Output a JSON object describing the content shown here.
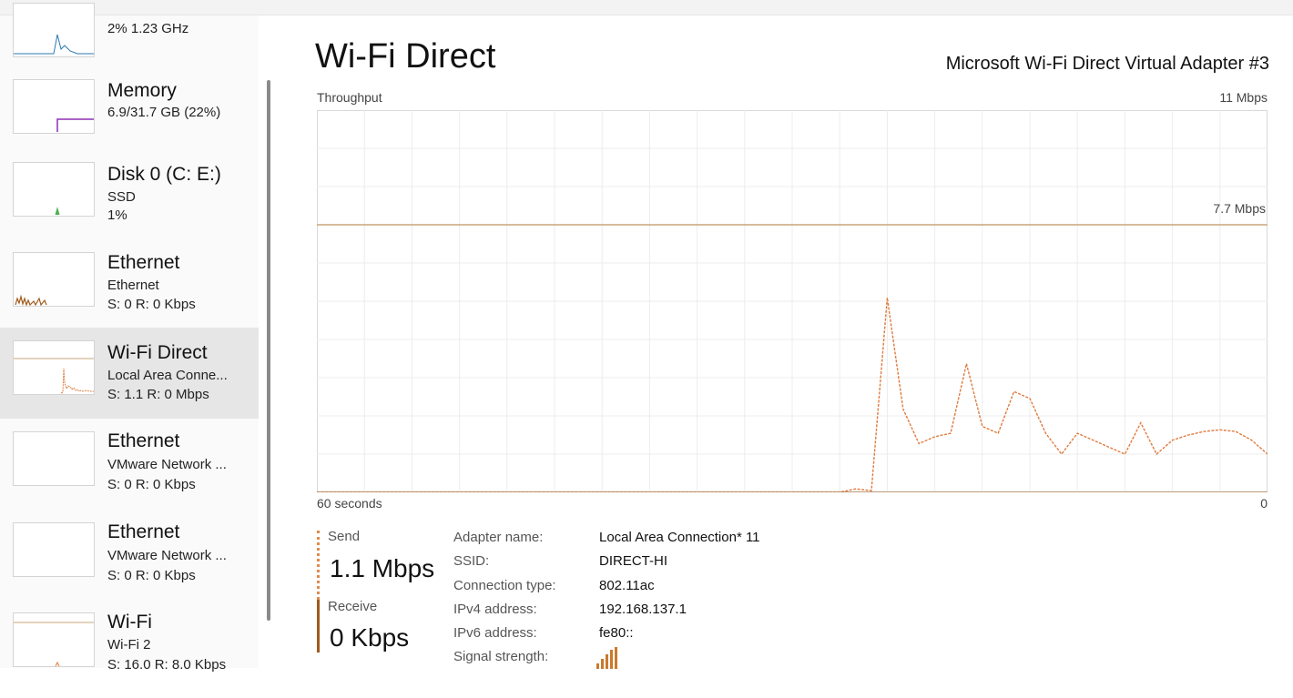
{
  "sidebar": {
    "items": [
      {
        "title": "",
        "subs": [
          "2% 1.23 GHz"
        ]
      },
      {
        "title": "Memory",
        "subs": [
          "6.9/31.7 GB (22%)"
        ]
      },
      {
        "title": "Disk 0 (C: E:)",
        "subs": [
          "SSD",
          "1%"
        ]
      },
      {
        "title": "Ethernet",
        "subs": [
          "Ethernet",
          "S: 0 R: 0 Kbps"
        ]
      },
      {
        "title": "Wi-Fi Direct",
        "subs": [
          "Local Area Conne...",
          "S: 1.1 R: 0 Mbps"
        ]
      },
      {
        "title": "Ethernet",
        "subs": [
          "VMware Network ...",
          "S: 0 R: 0 Kbps"
        ]
      },
      {
        "title": "Ethernet",
        "subs": [
          "VMware Network ...",
          "S: 0 R: 0 Kbps"
        ]
      },
      {
        "title": "Wi-Fi",
        "subs": [
          "Wi-Fi 2",
          "S: 16.0 R: 8.0 Kbps"
        ]
      }
    ]
  },
  "main": {
    "title": "Wi-Fi Direct",
    "adapter": "Microsoft Wi-Fi Direct Virtual Adapter #3",
    "chart_label": "Throughput",
    "max_label": "11 Mbps",
    "ref_label": "7.7 Mbps",
    "x_left_label": "60 seconds",
    "x_right_label": "0"
  },
  "stats": {
    "send_label": "Send",
    "send_value": "1.1 Mbps",
    "receive_label": "Receive",
    "receive_value": "0 Kbps"
  },
  "properties": [
    {
      "label": "Adapter name:",
      "value": "Local Area Connection* 11"
    },
    {
      "label": "SSID:",
      "value": "DIRECT-HI"
    },
    {
      "label": "Connection type:",
      "value": "802.11ac"
    },
    {
      "label": "IPv4 address:",
      "value": "192.168.137.1"
    },
    {
      "label": "IPv6 address:",
      "value": "fe80::"
    },
    {
      "label": "Signal strength:",
      "value": ""
    }
  ],
  "chart_data": {
    "type": "line",
    "title": "Throughput",
    "y_unit": "Mbps",
    "ylim": [
      0,
      11
    ],
    "xlim": [
      60,
      0
    ],
    "reference_line": 7.7,
    "grid": true,
    "series": [
      {
        "name": "Send",
        "color": "#e07b3f",
        "x": [
          60,
          59,
          58,
          57,
          56,
          55,
          54,
          53,
          52,
          51,
          50,
          49,
          48,
          47,
          46,
          45,
          44,
          43,
          42,
          41,
          40,
          39,
          38,
          37,
          36,
          35,
          34,
          33,
          32,
          31,
          30,
          29,
          28,
          27,
          26,
          25,
          24,
          23,
          22,
          21,
          20,
          19,
          18,
          17,
          16,
          15,
          14,
          13,
          12,
          11,
          10,
          9,
          8,
          7,
          6,
          5,
          4,
          3,
          2,
          1,
          0
        ],
        "y": [
          0,
          0,
          0,
          0,
          0,
          0,
          0,
          0,
          0,
          0,
          0,
          0,
          0,
          0,
          0,
          0,
          0,
          0,
          0,
          0,
          0,
          0,
          0,
          0,
          0,
          0,
          0,
          0,
          0,
          0,
          0,
          0,
          0,
          0,
          0.1,
          0.05,
          5.6,
          2.4,
          1.4,
          1.6,
          1.7,
          3.7,
          1.9,
          1.7,
          2.9,
          2.7,
          1.7,
          1.1,
          1.7,
          1.5,
          1.3,
          1.1,
          2.0,
          1.1,
          1.5,
          1.65,
          1.75,
          1.8,
          1.75,
          1.5,
          1.1
        ]
      },
      {
        "name": "Receive",
        "color": "#a05a1a",
        "x": [
          60,
          0
        ],
        "y": [
          0,
          0
        ]
      }
    ]
  },
  "colors": {
    "send": "#e07b3f",
    "receive": "#a05a1a",
    "ref_line": "#c8a57a",
    "grid": "#ececec",
    "selected": "#e6e6e6"
  }
}
